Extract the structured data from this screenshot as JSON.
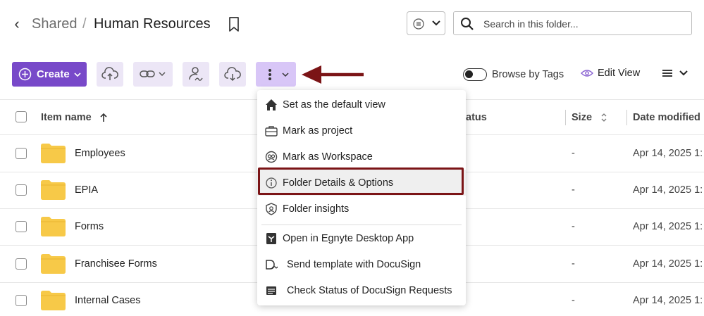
{
  "header": {
    "breadcrumb_parent": "Shared",
    "breadcrumb_sep": "/",
    "title": "Human Resources"
  },
  "search": {
    "placeholder": "Search in this folder..."
  },
  "toolbar": {
    "create_label": "Create",
    "browse_by_tags_label": "Browse by Tags",
    "edit_view_label": "Edit View",
    "browse_by_tags_on": false
  },
  "table": {
    "columns": {
      "name": "Item name",
      "status": "atus",
      "size": "Size",
      "date": "Date modified"
    },
    "rows": [
      {
        "name": "Employees",
        "size": "-",
        "date": "Apr 14, 2025 1:"
      },
      {
        "name": "EPIA",
        "size": "-",
        "date": "Apr 14, 2025 1:"
      },
      {
        "name": "Forms",
        "size": "-",
        "date": "Apr 14, 2025 1:"
      },
      {
        "name": "Franchisee Forms",
        "size": "-",
        "date": "Apr 14, 2025 1:"
      },
      {
        "name": "Internal Cases",
        "size": "-",
        "date": "Apr 14, 2025 1:"
      }
    ]
  },
  "menu": {
    "items": [
      {
        "label": "Set as the default view",
        "icon": "home-icon"
      },
      {
        "label": "Mark as project",
        "icon": "briefcase-icon"
      },
      {
        "label": "Mark as Workspace",
        "icon": "workspace-icon"
      },
      {
        "label": "Folder Details & Options",
        "icon": "info-icon",
        "highlighted": true
      },
      {
        "label": "Folder insights",
        "icon": "shield-insights-icon"
      },
      {
        "label": "Open in Egnyte Desktop App",
        "icon": "egnyte-desktop-icon"
      },
      {
        "label": "Send template with DocuSign",
        "icon": "docusign-icon"
      },
      {
        "label": "Check Status of DocuSign Requests",
        "icon": "status-list-icon"
      }
    ]
  },
  "colors": {
    "primary": "#7849c9",
    "tool_bg": "#ece6f6",
    "tool_active_bg": "#d8c6f7",
    "annotation": "#7b1416",
    "folder": "#f7c948"
  }
}
